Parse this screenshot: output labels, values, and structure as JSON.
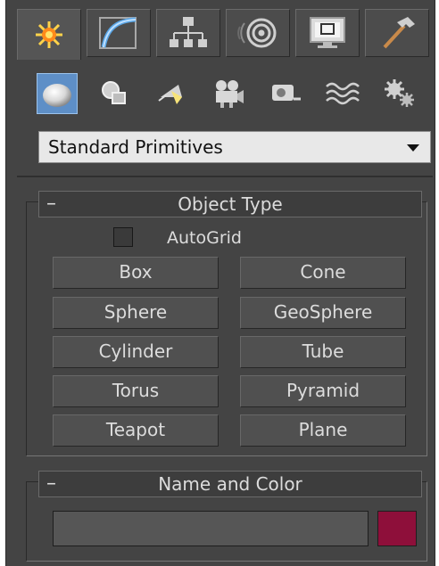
{
  "create_panel": {
    "tabs": [
      {
        "name": "create",
        "icon": "sun-star-icon",
        "active": true
      },
      {
        "name": "modify",
        "icon": "bent-curve-icon"
      },
      {
        "name": "hierarchy",
        "icon": "hierarchy-tree-icon"
      },
      {
        "name": "motion",
        "icon": "motion-rings-icon"
      },
      {
        "name": "display",
        "icon": "monitor-icon"
      },
      {
        "name": "utilities",
        "icon": "hammer-icon"
      }
    ],
    "categories": [
      {
        "name": "geometry",
        "icon": "sphere-icon",
        "active": true
      },
      {
        "name": "shapes",
        "icon": "shapes-icon"
      },
      {
        "name": "lights",
        "icon": "light-icon"
      },
      {
        "name": "cameras",
        "icon": "camera-icon"
      },
      {
        "name": "helpers",
        "icon": "tape-helper-icon"
      },
      {
        "name": "space_warps",
        "icon": "waves-icon"
      },
      {
        "name": "systems",
        "icon": "gears-icon"
      }
    ],
    "dropdown": {
      "selected": "Standard Primitives"
    },
    "object_type": {
      "collapse_symbol": "–",
      "title": "Object Type",
      "autogrid_label": "AutoGrid",
      "autogrid_checked": false,
      "buttons": [
        "Box",
        "Cone",
        "Sphere",
        "GeoSphere",
        "Cylinder",
        "Tube",
        "Torus",
        "Pyramid",
        "Teapot",
        "Plane"
      ]
    },
    "name_and_color": {
      "collapse_symbol": "–",
      "title": "Name and Color",
      "name_value": "",
      "color": "#8e0f3a"
    }
  },
  "colors": {
    "panel_bg": "#444444",
    "active_category": "#5e8fc7",
    "object_color": "#8e0f3a"
  }
}
